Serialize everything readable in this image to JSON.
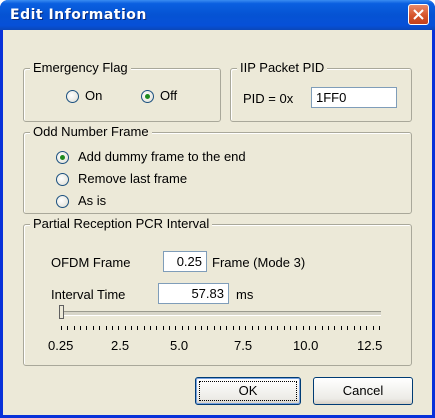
{
  "window": {
    "title": "Edit Information"
  },
  "emergency_flag": {
    "legend": "Emergency Flag",
    "options": [
      {
        "label": "On",
        "selected": false
      },
      {
        "label": "Off",
        "selected": true
      }
    ]
  },
  "iip_packet_pid": {
    "legend": "IIP Packet PID",
    "prefix": "PID = 0x",
    "value": "1FF0"
  },
  "odd_number_frame": {
    "legend": "Odd Number Frame",
    "options": [
      {
        "label": "Add dummy frame to the end",
        "selected": true
      },
      {
        "label": "Remove last frame",
        "selected": false
      },
      {
        "label": "As is",
        "selected": false
      }
    ]
  },
  "pcr_interval": {
    "legend": "Partial Reception PCR Interval",
    "ofdm_label": "OFDM Frame",
    "ofdm_value": "0.25",
    "ofdm_unit": "Frame (Mode 3)",
    "interval_label": "Interval Time",
    "interval_value": "57.83",
    "interval_unit": "ms",
    "slider": {
      "min": 0.25,
      "max": 12.5,
      "value": 0.25
    },
    "scale_labels": [
      "0.25",
      "2.5",
      "5.0",
      "7.5",
      "10.0",
      "12.5"
    ]
  },
  "buttons": {
    "ok": "OK",
    "cancel": "Cancel"
  }
}
